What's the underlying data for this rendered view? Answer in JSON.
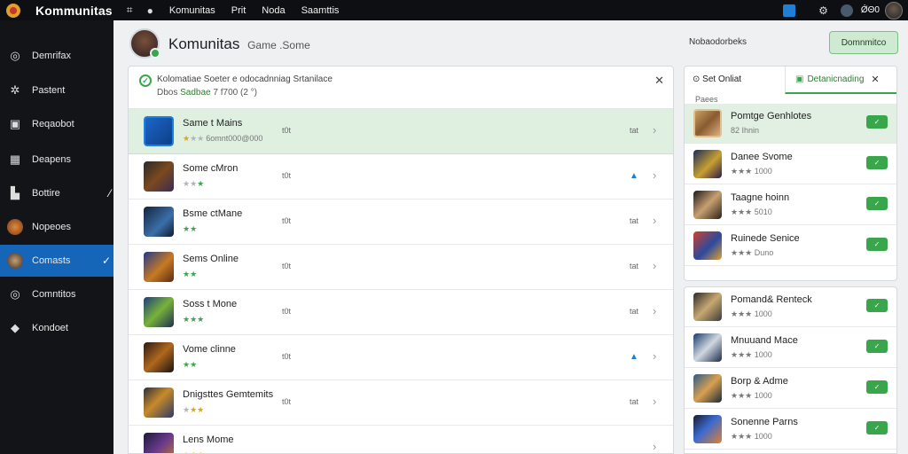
{
  "topbar": {
    "brand": "Kommunitas",
    "nav": [
      "Komunitas",
      "Prit",
      "Noda",
      "Saamttis"
    ],
    "username": "ǾΘ0"
  },
  "sidebar": {
    "items": [
      {
        "label": "Demrifax",
        "icon": "play-circle-icon"
      },
      {
        "label": "Pastent",
        "icon": "pinwheel-icon"
      },
      {
        "label": "Reqaobot",
        "icon": "briefcase-icon"
      },
      {
        "label": "Deapens",
        "icon": "grid-icon"
      },
      {
        "label": "Bottire",
        "icon": "chart-icon"
      },
      {
        "label": "Nopeoes",
        "icon": "avatar-icon"
      },
      {
        "label": "Comasts",
        "icon": "avatar-icon"
      },
      {
        "label": "Comntitos",
        "icon": "target-icon"
      },
      {
        "label": "Kondoet",
        "icon": "tag-icon"
      }
    ],
    "active_index": 6
  },
  "header": {
    "title": "Komunitas",
    "subtitle": "Game .Some",
    "note": "Nobaodorbeks",
    "primary_button": "Domnmitco"
  },
  "notice": {
    "message": "Kolomatiae Soeter e odocadnniag Srtanilace",
    "meta_prefix": "Dbos",
    "meta_highlight": "Sadbae",
    "meta_suffix": "7 f700 (2 °)"
  },
  "games": [
    {
      "title": "Same t Mains",
      "stars": "★★★",
      "star_colors": [
        "y",
        "n",
        "n"
      ],
      "rating": "6omnt000@000",
      "count": "t0t",
      "right": "tat",
      "selected": true
    },
    {
      "title": "Some cMron",
      "stars": "★★★",
      "star_colors": [
        "n",
        "n",
        "g"
      ],
      "rating": "",
      "count": "t0t",
      "right": "▲",
      "selected": false
    },
    {
      "title": "Bsme ctMane",
      "stars": "★★",
      "star_colors": [
        "g",
        "g"
      ],
      "rating": "",
      "count": "t0t",
      "right": "tat",
      "selected": false
    },
    {
      "title": "Sems Online",
      "stars": "★★",
      "star_colors": [
        "g",
        "g"
      ],
      "rating": "",
      "count": "t0t",
      "right": "tat",
      "selected": false
    },
    {
      "title": "Soss t Mone",
      "stars": "★★★",
      "star_colors": [
        "g",
        "g",
        "g"
      ],
      "rating": "",
      "count": "t0t",
      "right": "tat",
      "selected": false
    },
    {
      "title": "Vome clinne",
      "stars": "2 ★★",
      "star_colors": [
        "g",
        "g"
      ],
      "rating": "",
      "count": "t0t",
      "right": "▲",
      "selected": false
    },
    {
      "title": "Dnigsttes Gemtemits",
      "stars": "★★★",
      "star_colors": [
        "n",
        "y",
        "y"
      ],
      "rating": "",
      "count": "t0t",
      "right": "tat",
      "selected": false
    },
    {
      "title": "Lens Mome",
      "stars": "★★★",
      "star_colors": [
        "n",
        "y",
        "y"
      ],
      "rating": "",
      "count": "",
      "right": "",
      "selected": false
    }
  ],
  "right_panel": {
    "tab1": "Set Onliat",
    "tab2": "Detanicnading",
    "label": "Paees",
    "items": [
      {
        "title": "Pomtge Genhlotes",
        "sub": "82 Ihnin",
        "selected": true
      },
      {
        "title": "Danee Svome",
        "sub": "★★★ 1000",
        "selected": false
      },
      {
        "title": "Taagne hoinn",
        "sub": "★★★ 5010",
        "selected": false
      },
      {
        "title": "Ruinede Senice",
        "sub": "★★★ Duno",
        "selected": false
      }
    ],
    "items2": [
      {
        "title": "Pomand& Renteck",
        "sub": "★★★ 1000"
      },
      {
        "title": "Mnuuand Mace",
        "sub": "★★★ 1000"
      },
      {
        "title": "Borp & Adme",
        "sub": "★★★ 1000"
      },
      {
        "title": "Sonenne Parns",
        "sub": "★★★ 1000"
      }
    ],
    "button_glyph": "✓"
  }
}
